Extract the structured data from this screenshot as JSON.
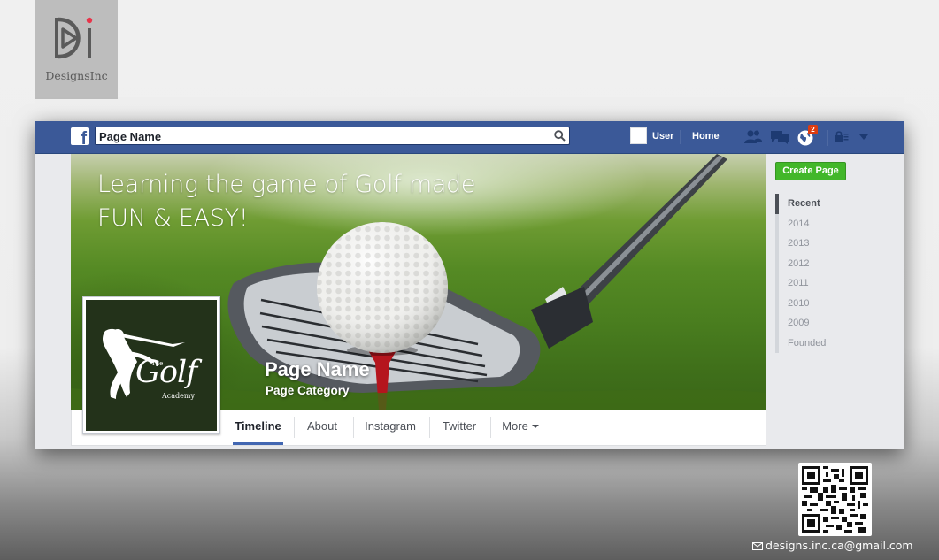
{
  "brand": {
    "name": "DesignsInc",
    "accent": "#e8344a"
  },
  "facebook": {
    "topbar_color": "#3b5998",
    "search": {
      "value": "Page Name",
      "placeholder": ""
    },
    "nav": {
      "user_label": "User",
      "home_label": "Home",
      "notifications_count": "2"
    }
  },
  "cover": {
    "tagline_line1": "Learning the game of Golf made",
    "tagline_line2": "FUN & EASY!",
    "page_name": "Page Name",
    "page_category": "Page Category"
  },
  "profile_logo": {
    "the": "The",
    "golf": "Golf",
    "academy": "Academy"
  },
  "tabs": [
    {
      "label": "Timeline",
      "active": true
    },
    {
      "label": "About",
      "active": false
    },
    {
      "label": "Instagram",
      "active": false
    },
    {
      "label": "Twitter",
      "active": false
    },
    {
      "label": "More",
      "active": false
    }
  ],
  "sidebar": {
    "create_page_label": "Create Page",
    "years": [
      "Recent",
      "2014",
      "2013",
      "2012",
      "2011",
      "2010",
      "2009",
      "Founded"
    ],
    "active_year": "Recent"
  },
  "footer": {
    "email": "designs.inc.ca@gmail.com",
    "qr_icon": "qr-code"
  }
}
